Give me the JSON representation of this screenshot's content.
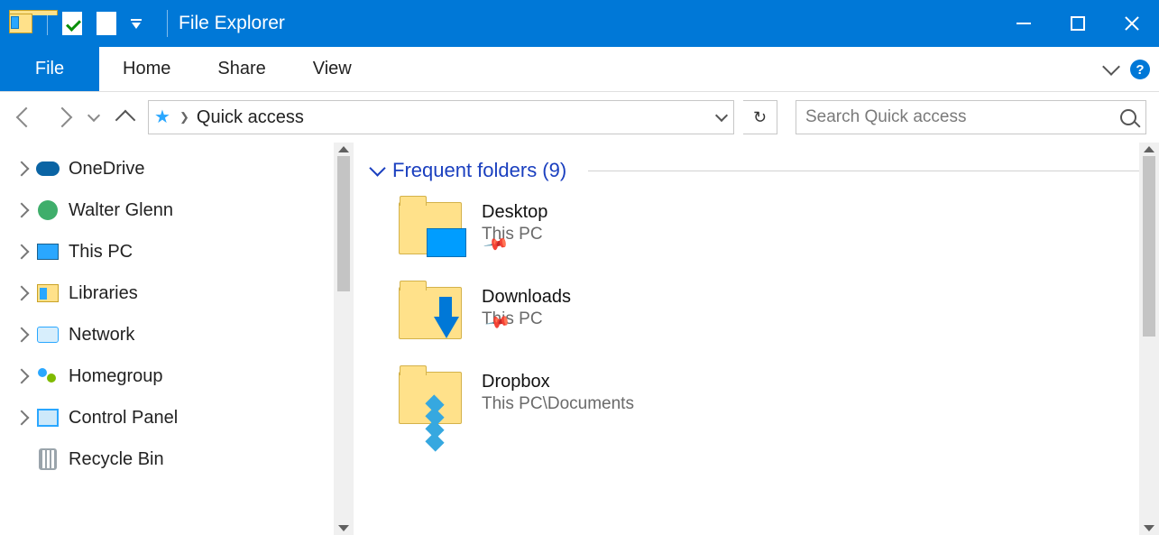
{
  "titlebar": {
    "title": "File Explorer"
  },
  "ribbon": {
    "file": "File",
    "tabs": [
      "Home",
      "Share",
      "View"
    ]
  },
  "address": {
    "location": "Quick access"
  },
  "search": {
    "placeholder": "Search Quick access"
  },
  "navpane": {
    "items": [
      {
        "label": "OneDrive",
        "expandable": true
      },
      {
        "label": "Walter Glenn",
        "expandable": true
      },
      {
        "label": "This PC",
        "expandable": true
      },
      {
        "label": "Libraries",
        "expandable": true
      },
      {
        "label": "Network",
        "expandable": true
      },
      {
        "label": "Homegroup",
        "expandable": true
      },
      {
        "label": "Control Panel",
        "expandable": true
      },
      {
        "label": "Recycle Bin",
        "expandable": false
      }
    ]
  },
  "content": {
    "group_title": "Frequent folders (9)",
    "items": [
      {
        "name": "Desktop",
        "location": "This PC"
      },
      {
        "name": "Downloads",
        "location": "This PC"
      },
      {
        "name": "Dropbox",
        "location": "This PC\\Documents"
      }
    ]
  }
}
